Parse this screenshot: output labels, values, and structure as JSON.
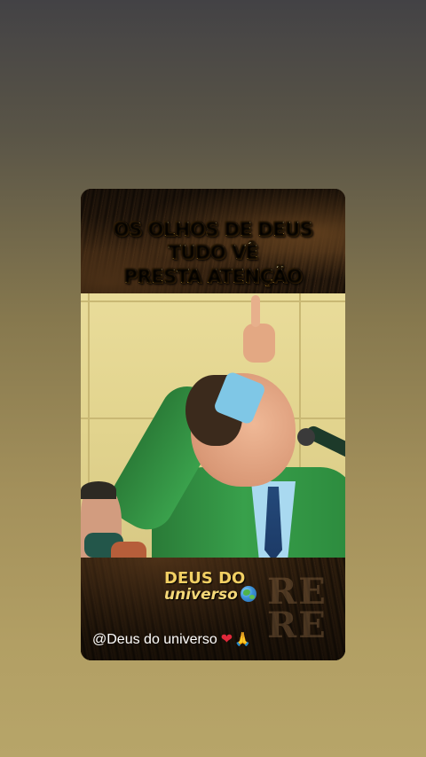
{
  "post": {
    "headline_lines": [
      "OS OLHOS DE DEUS",
      "TUDO VÊ",
      "PRESTA ATENÇÃO"
    ],
    "brand_line1": "DEUS DO",
    "brand_line2": "universo",
    "watermark": "RE\nRE",
    "caption_text": "@Deus do universo",
    "caption_emoji": [
      "red-heart-icon",
      "praying-hands-icon"
    ],
    "brand_emoji": "globe-icon"
  },
  "colors": {
    "headline_gold": "#f1c24e",
    "brand_gold": "#f2cf63",
    "caption_text": "#ffffff",
    "heart": "#e0283a",
    "background_top": "#434245",
    "background_bottom": "#b7a569"
  }
}
